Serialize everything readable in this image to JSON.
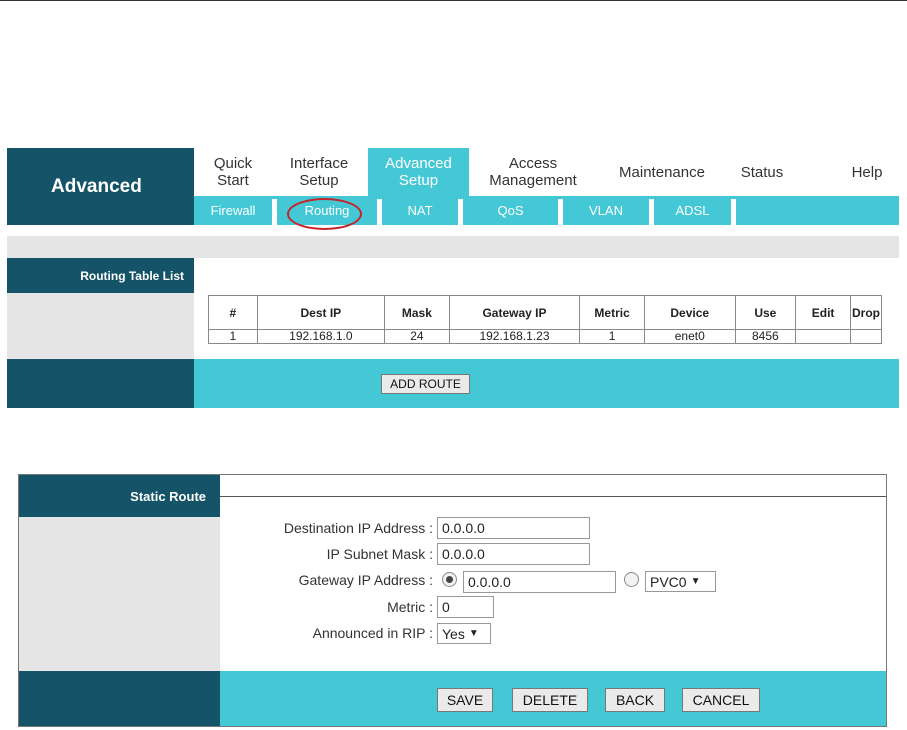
{
  "brand": "Advanced",
  "nav": {
    "items": [
      {
        "line1": "Quick",
        "line2": "Start"
      },
      {
        "line1": "Interface",
        "line2": "Setup"
      },
      {
        "line1": "Advanced",
        "line2": "Setup"
      },
      {
        "line1": "Access",
        "line2": "Management"
      },
      {
        "line1": "Maintenance",
        "line2": ""
      },
      {
        "line1": "Status",
        "line2": ""
      },
      {
        "line1": "Help",
        "line2": ""
      }
    ],
    "active": "Advanced Setup"
  },
  "subnav": {
    "items": [
      "Firewall",
      "Routing",
      "NAT",
      "QoS",
      "VLAN",
      "ADSL"
    ],
    "active": "Routing"
  },
  "routing_table": {
    "section_title": "Routing Table List",
    "headers": [
      "#",
      "Dest IP",
      "Mask",
      "Gateway IP",
      "Metric",
      "Device",
      "Use",
      "Edit",
      "Drop"
    ],
    "rows": [
      [
        "1",
        "192.168.1.0",
        "24",
        "192.168.1.23",
        "1",
        "enet0",
        "8456",
        "",
        ""
      ]
    ],
    "add_button": "ADD ROUTE"
  },
  "static_route": {
    "section_title": "Static Route",
    "dest_ip_label": "Destination IP Address :",
    "dest_ip_value": "0.0.0.0",
    "subnet_label": "IP Subnet Mask :",
    "subnet_value": "0.0.0.0",
    "gateway_label": "Gateway IP Address :",
    "gateway_value": "0.0.0.0",
    "gateway_mode": "ip",
    "pvc_value": "PVC0",
    "metric_label": "Metric :",
    "metric_value": "0",
    "rip_label": "Announced in RIP :",
    "rip_value": "Yes",
    "buttons": {
      "save": "SAVE",
      "delete": "DELETE",
      "back": "BACK",
      "cancel": "CANCEL"
    }
  },
  "colors": {
    "dark_teal": "#155468",
    "accent_cyan": "#45c8d5",
    "panel_gray": "#e5e5e5",
    "highlight_ring": "#c4242b"
  }
}
